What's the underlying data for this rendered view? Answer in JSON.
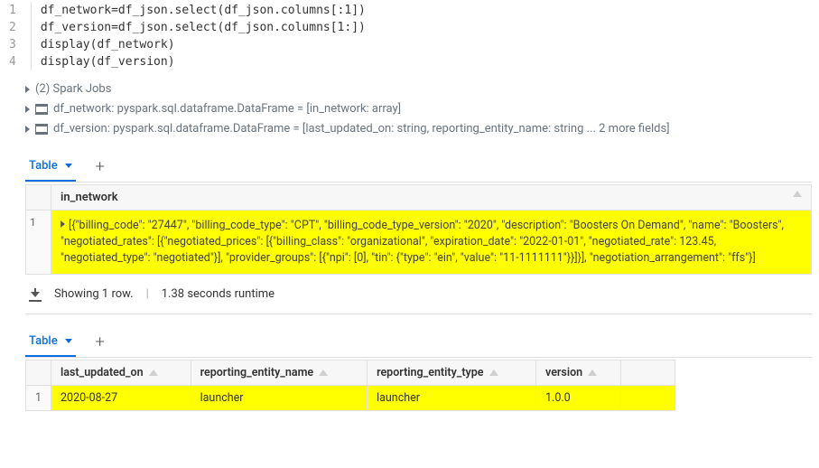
{
  "code": {
    "lines": [
      "df_network=df_json.select(df_json.columns[:1])",
      "df_version=df_json.select(df_json.columns[1:])",
      "display(df_network)",
      "display(df_version)"
    ]
  },
  "outline": {
    "spark_jobs": "(2) Spark Jobs",
    "df_network": "df_network:  pyspark.sql.dataframe.DataFrame = [in_network: array]",
    "df_version": "df_version:  pyspark.sql.dataframe.DataFrame = [last_updated_on: string, reporting_entity_name: string ... 2 more fields]"
  },
  "tabs": {
    "table_label": "Table"
  },
  "table1": {
    "header": "in_network",
    "row": "[{\"billing_code\": \"27447\", \"billing_code_type\": \"CPT\", \"billing_code_type_version\": \"2020\", \"description\": \"Boosters On Demand\", \"name\": \"Boosters\", \"negotiated_rates\": [{\"negotiated_prices\": [{\"billing_class\": \"organizational\", \"expiration_date\": \"2022-01-01\", \"negotiated_rate\": 123.45, \"negotiated_type\": \"negotiated\"}], \"provider_groups\": [{\"npi\": [0], \"tin\": {\"type\": \"ein\", \"value\": \"11-1111111\"}}]}], \"negotiation_arrangement\": \"ffs\"}]",
    "row_index": "1"
  },
  "footer": {
    "text": "Showing 1 row.",
    "runtime": "1.38 seconds runtime"
  },
  "table2": {
    "headers": [
      "last_updated_on",
      "reporting_entity_name",
      "reporting_entity_type",
      "version"
    ],
    "row": {
      "index": "1",
      "last_updated_on": "2020-08-27",
      "reporting_entity_name": "launcher",
      "reporting_entity_type": "launcher",
      "version": "1.0.0"
    }
  }
}
